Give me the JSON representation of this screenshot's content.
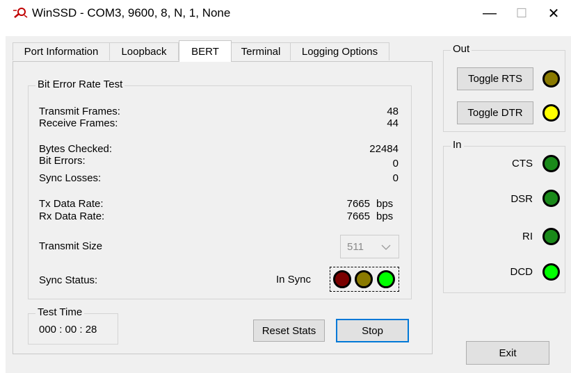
{
  "window": {
    "title": "WinSSD - COM3, 9600, 8, N, 1, None",
    "minimize_glyph": "—",
    "maximize_glyph": "☐",
    "close_glyph": "✕"
  },
  "tabs": [
    {
      "label": "Port Information"
    },
    {
      "label": "Loopback"
    },
    {
      "label": "BERT",
      "active": true
    },
    {
      "label": "Terminal"
    },
    {
      "label": "Logging Options"
    }
  ],
  "bert": {
    "group_label": "Bit Error Rate Test",
    "transmit_frames_label": "Transmit Frames:",
    "transmit_frames_value": "48",
    "receive_frames_label": "Receive Frames:",
    "receive_frames_value": "44",
    "bytes_checked_label": "Bytes Checked:",
    "bytes_checked_value": "22484",
    "bit_errors_label": "Bit Errors:",
    "bit_errors_value": "0",
    "sync_losses_label": "Sync Losses:",
    "sync_losses_value": "0",
    "tx_rate_label": "Tx Data Rate:",
    "tx_rate_value": "7665",
    "rx_rate_label": "Rx Data Rate:",
    "rx_rate_value": "7665",
    "rate_unit": "bps",
    "transmit_size_label": "Transmit Size",
    "transmit_size_value": "511",
    "sync_status_label": "Sync Status:",
    "sync_status_value": "In Sync"
  },
  "test_time": {
    "group_label": "Test Time",
    "value": "000 : 00 : 28"
  },
  "buttons": {
    "reset_stats": "Reset Stats",
    "stop": "Stop",
    "exit": "Exit"
  },
  "out_panel": {
    "group_label": "Out",
    "toggle_rts": "Toggle RTS",
    "toggle_dtr": "Toggle DTR"
  },
  "in_panel": {
    "group_label": "In",
    "signals": [
      {
        "label": "CTS"
      },
      {
        "label": "DSR"
      },
      {
        "label": "RI"
      },
      {
        "label": "DCD"
      }
    ]
  },
  "colors": {
    "led_olive": "#8a7a00",
    "led_yellow": "#ffff00",
    "led_green": "#1a8a1a",
    "led_bright_green": "#00ff00",
    "led_dark_red": "#7a0000",
    "stop_button_border": "#0078d7"
  }
}
